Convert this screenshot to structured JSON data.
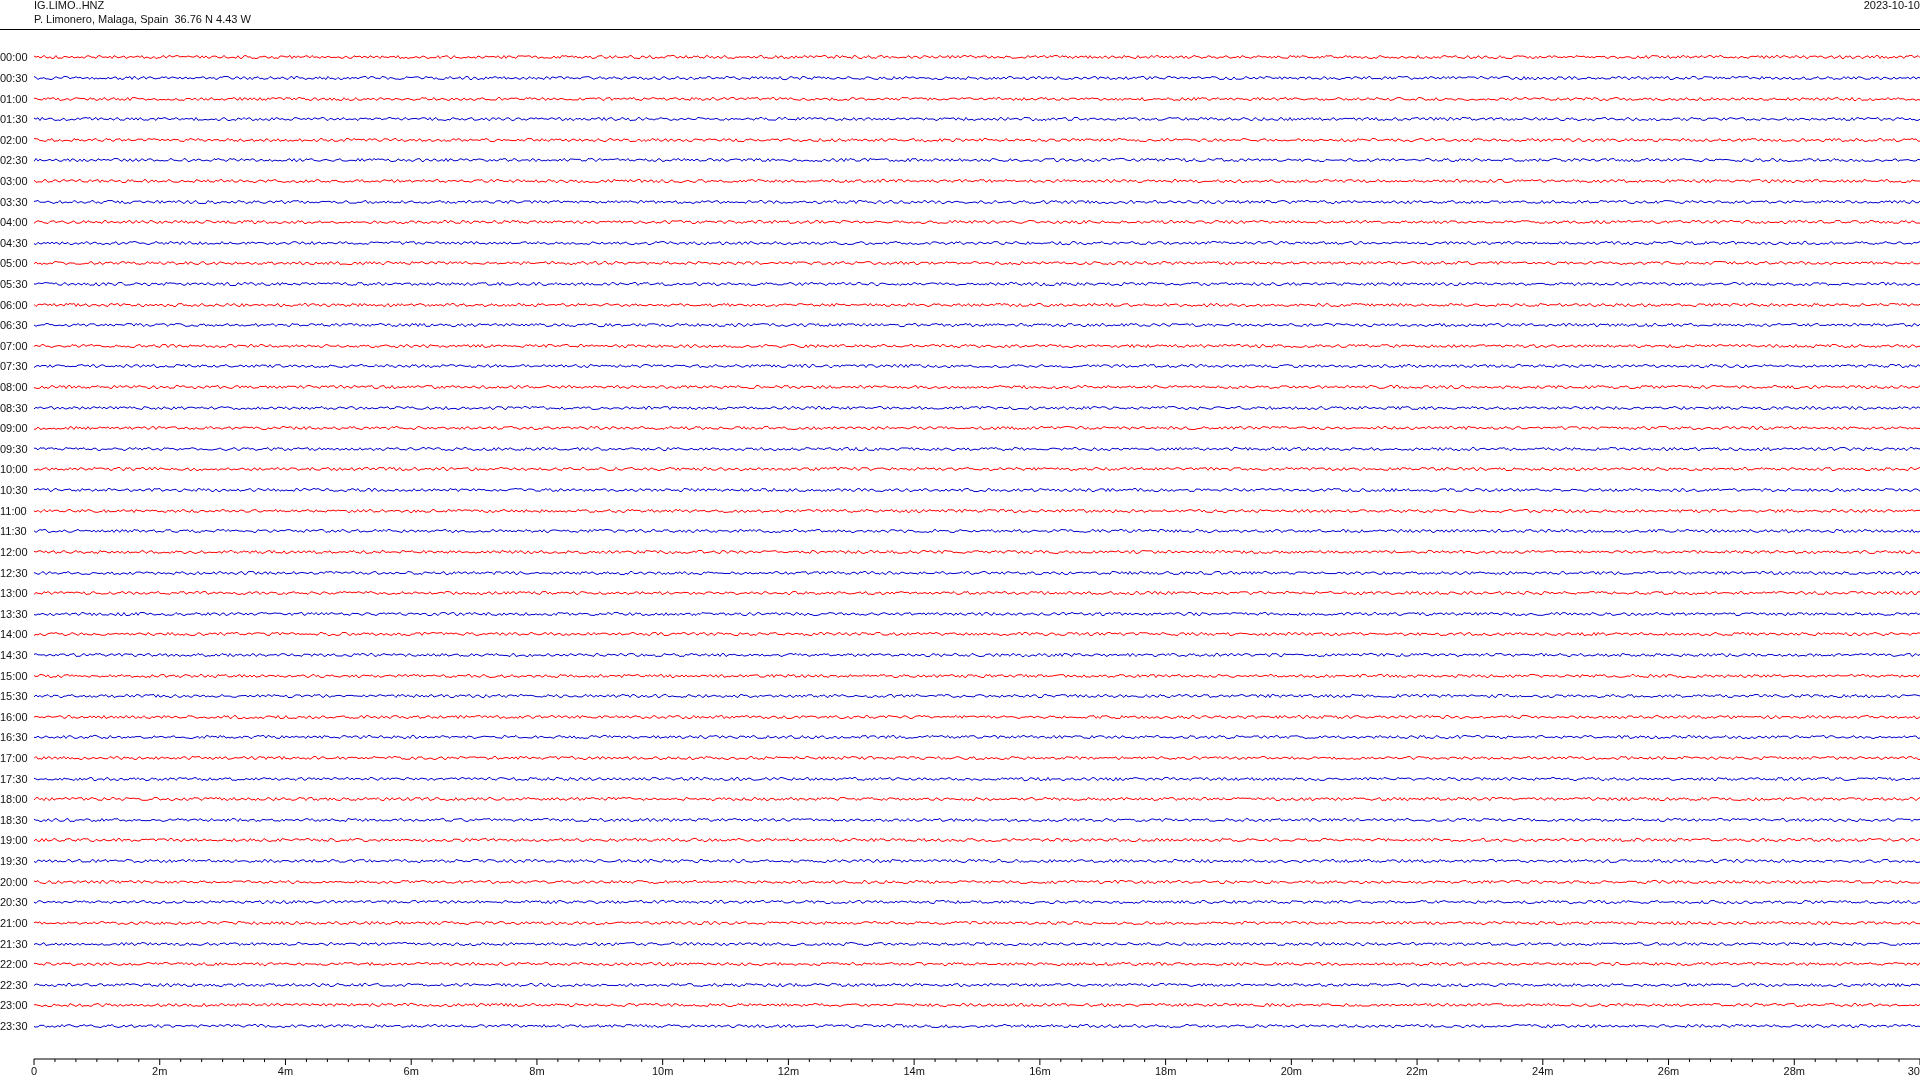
{
  "header": {
    "station": "IG.LIMO..HNZ",
    "location": "P. Limonero, Malaga, Spain  36.76 N 4.43 W",
    "date": "2023-10-10"
  },
  "rows": [
    {
      "label": "00:00",
      "color": "#ff0000"
    },
    {
      "label": "00:30",
      "color": "#0000cc"
    },
    {
      "label": "01:00",
      "color": "#ff0000"
    },
    {
      "label": "01:30",
      "color": "#0000cc"
    },
    {
      "label": "02:00",
      "color": "#ff0000"
    },
    {
      "label": "02:30",
      "color": "#0000cc"
    },
    {
      "label": "03:00",
      "color": "#ff0000"
    },
    {
      "label": "03:30",
      "color": "#0000cc"
    },
    {
      "label": "04:00",
      "color": "#ff0000"
    },
    {
      "label": "04:30",
      "color": "#0000cc"
    },
    {
      "label": "05:00",
      "color": "#ff0000"
    },
    {
      "label": "05:30",
      "color": "#0000cc"
    },
    {
      "label": "06:00",
      "color": "#ff0000"
    },
    {
      "label": "06:30",
      "color": "#0000cc"
    },
    {
      "label": "07:00",
      "color": "#ff0000"
    },
    {
      "label": "07:30",
      "color": "#0000cc"
    },
    {
      "label": "08:00",
      "color": "#ff0000"
    },
    {
      "label": "08:30",
      "color": "#0000cc"
    },
    {
      "label": "09:00",
      "color": "#ff0000"
    },
    {
      "label": "09:30",
      "color": "#0000cc"
    },
    {
      "label": "10:00",
      "color": "#ff0000"
    },
    {
      "label": "10:30",
      "color": "#0000cc"
    },
    {
      "label": "11:00",
      "color": "#ff0000"
    },
    {
      "label": "11:30",
      "color": "#0000cc"
    },
    {
      "label": "12:00",
      "color": "#ff0000"
    },
    {
      "label": "12:30",
      "color": "#0000cc"
    },
    {
      "label": "13:00",
      "color": "#ff0000"
    },
    {
      "label": "13:30",
      "color": "#0000cc"
    },
    {
      "label": "14:00",
      "color": "#ff0000"
    },
    {
      "label": "14:30",
      "color": "#0000cc"
    },
    {
      "label": "15:00",
      "color": "#ff0000"
    },
    {
      "label": "15:30",
      "color": "#0000cc"
    },
    {
      "label": "16:00",
      "color": "#ff0000"
    },
    {
      "label": "16:30",
      "color": "#0000cc"
    },
    {
      "label": "17:00",
      "color": "#ff0000"
    },
    {
      "label": "17:30",
      "color": "#0000cc"
    },
    {
      "label": "18:00",
      "color": "#ff0000"
    },
    {
      "label": "18:30",
      "color": "#0000cc"
    },
    {
      "label": "19:00",
      "color": "#ff0000"
    },
    {
      "label": "19:30",
      "color": "#0000cc"
    },
    {
      "label": "20:00",
      "color": "#ff0000"
    },
    {
      "label": "20:30",
      "color": "#0000cc"
    },
    {
      "label": "21:00",
      "color": "#ff0000"
    },
    {
      "label": "21:30",
      "color": "#0000cc"
    },
    {
      "label": "22:00",
      "color": "#ff0000"
    },
    {
      "label": "22:30",
      "color": "#0000cc"
    },
    {
      "label": "23:00",
      "color": "#ff0000"
    },
    {
      "label": "23:30",
      "color": "#0000cc"
    }
  ],
  "x_axis": {
    "labels": [
      "0",
      "2m",
      "4m",
      "6m",
      "8m",
      "10m",
      "12m",
      "14m",
      "16m",
      "18m",
      "20m",
      "22m",
      "24m",
      "26m",
      "28m",
      "30"
    ]
  }
}
